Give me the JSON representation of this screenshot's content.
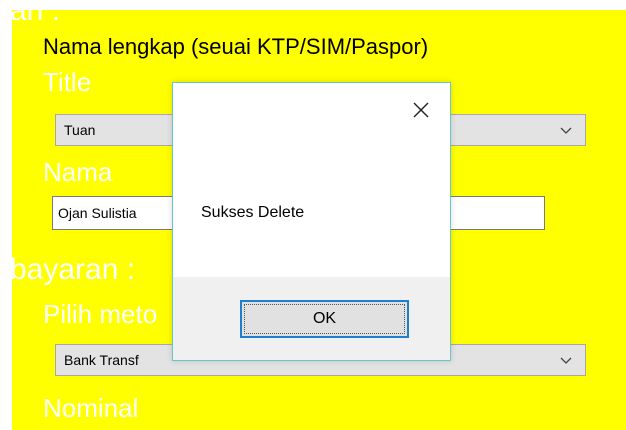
{
  "form": {
    "section1_heading": "an :",
    "full_name_label": "Nama lengkap (seuai KTP/SIM/Paspor)",
    "title_label": "Title",
    "title_select": {
      "value": "Tuan"
    },
    "name_label": "Nama",
    "name_input": {
      "value": "Ojan Sulistia"
    },
    "section2_heading": "bayaran :",
    "method_label": "Pilih meto",
    "method_select": {
      "value": "Bank Transf"
    },
    "nominal_label": "Nominal"
  },
  "dialog": {
    "message": "Sukses Delete",
    "ok_label": "OK",
    "close_icon": "close-icon"
  },
  "colors": {
    "form_background": "#ffff00",
    "dialog_border": "#65c7cc",
    "button_focus": "#1e7fd0",
    "footer": "#f0f0f0"
  },
  "icons": [
    "chevron-down-icon",
    "close-icon"
  ]
}
